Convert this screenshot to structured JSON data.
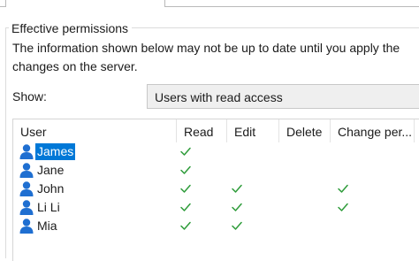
{
  "section": {
    "legend": "Effective permissions",
    "info": "The information shown below may not be up to date until you apply the changes on the server."
  },
  "filter": {
    "label": "Show:",
    "value": "Users with read access"
  },
  "table": {
    "columns": [
      "User",
      "Read",
      "Edit",
      "Delete",
      "Change per..."
    ],
    "rows": [
      {
        "user": "James",
        "read": true,
        "edit": false,
        "delete": false,
        "change": false,
        "selected": true
      },
      {
        "user": "Jane",
        "read": true,
        "edit": false,
        "delete": false,
        "change": false,
        "selected": false
      },
      {
        "user": "John",
        "read": true,
        "edit": true,
        "delete": false,
        "change": true,
        "selected": false
      },
      {
        "user": "Li Li",
        "read": true,
        "edit": true,
        "delete": false,
        "change": true,
        "selected": false
      },
      {
        "user": "Mia",
        "read": true,
        "edit": true,
        "delete": false,
        "change": false,
        "selected": false
      }
    ]
  },
  "icons": {
    "user": "user-icon",
    "check": "check-icon"
  },
  "colors": {
    "selection": "#0078d7",
    "check": "#2e9c3a",
    "user_icon": "#1f6fd1"
  }
}
